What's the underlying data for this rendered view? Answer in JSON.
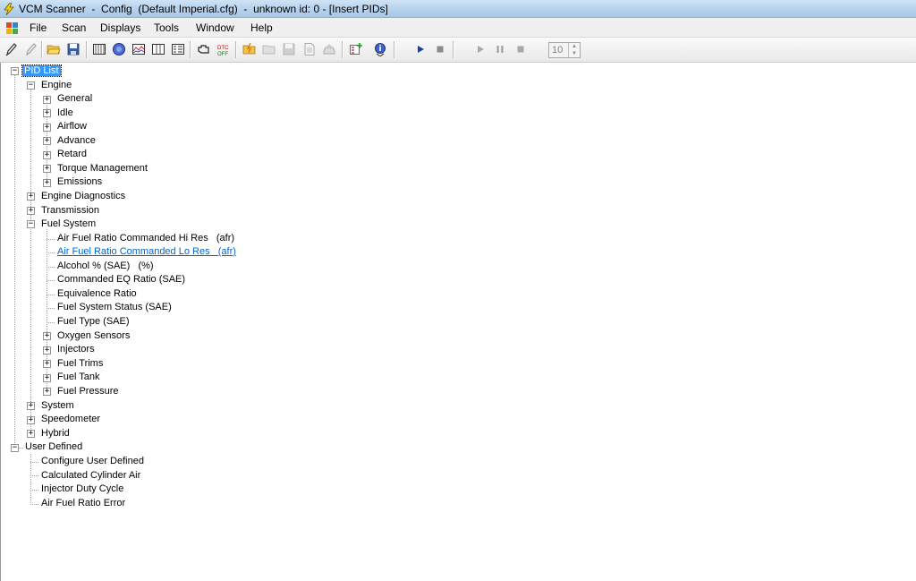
{
  "window": {
    "title": "VCM Scanner  -  Config  (Default Imperial.cfg)  -  unknown id: 0 - [Insert PIDs]"
  },
  "menu": [
    "File",
    "Scan",
    "Displays",
    "Tools",
    "Window",
    "Help"
  ],
  "toolbar": {
    "spinner_value": "10"
  },
  "tree": {
    "root": "PID List",
    "engine": {
      "label": "Engine",
      "children": [
        "General",
        "Idle",
        "Airflow",
        "Advance",
        "Retard",
        "Torque Management",
        "Emissions"
      ]
    },
    "engine_diagnostics": "Engine Diagnostics",
    "transmission": "Transmission",
    "fuel_system": {
      "label": "Fuel System",
      "children": [
        "Air Fuel Ratio Commanded Hi Res   (afr)",
        "Air Fuel Ratio Commanded Lo Res   (afr)",
        "Alcohol % (SAE)   (%)",
        "Commanded EQ Ratio (SAE)",
        "Equivalence Ratio",
        "Fuel System Status (SAE)",
        "Fuel Type (SAE)",
        "Oxygen Sensors",
        "Injectors",
        "Fuel Trims",
        "Fuel Tank",
        "Fuel Pressure"
      ]
    },
    "system": "System",
    "speedometer": "Speedometer",
    "hybrid": "Hybrid",
    "user_defined": {
      "label": "User Defined",
      "children": [
        "Configure User Defined",
        "Calculated Cylinder Air",
        "Injector Duty Cycle",
        "Air Fuel Ratio Error"
      ]
    }
  },
  "colors": {
    "selection": "#3399ff",
    "link": "#0066cc",
    "play": "#1f3fa6"
  }
}
